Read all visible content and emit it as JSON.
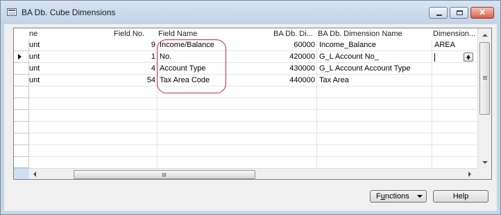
{
  "window": {
    "title": "BA Db. Cube Dimensions",
    "close_glyph": "✕"
  },
  "grid": {
    "columns": [
      {
        "label": "ne"
      },
      {
        "label": "Field No."
      },
      {
        "label": "Field Name"
      },
      {
        "label": "BA Db. Di..."
      },
      {
        "label": "BA Db. Dimension Name"
      },
      {
        "label": "Dimension..."
      }
    ],
    "rows": [
      {
        "col1": "unt",
        "field_no": "9",
        "field_name": "Income/Balance",
        "dim_code": "60000",
        "dim_name": "Income_Balance",
        "dimension": "AREA"
      },
      {
        "col1": "unt",
        "field_no": "1",
        "field_name": "No.",
        "dim_code": "420000",
        "dim_name": "G_L Account No_",
        "dimension": ""
      },
      {
        "col1": "unt",
        "field_no": "4",
        "field_name": "Account Type",
        "dim_code": "430000",
        "dim_name": "G_L Account Account Type",
        "dimension": ""
      },
      {
        "col1": "unt",
        "field_no": "54",
        "field_name": "Tax Area Code",
        "dim_code": "440000",
        "dim_name": "Tax Area",
        "dimension": ""
      }
    ],
    "empty_rows": 7
  },
  "buttons": {
    "functions_prefix": "F",
    "functions_underlined": "u",
    "functions_suffix": "nctions",
    "help": "Help"
  },
  "colors": {
    "highlight": "#c0283a",
    "titlebar": "#c6d4e4"
  }
}
